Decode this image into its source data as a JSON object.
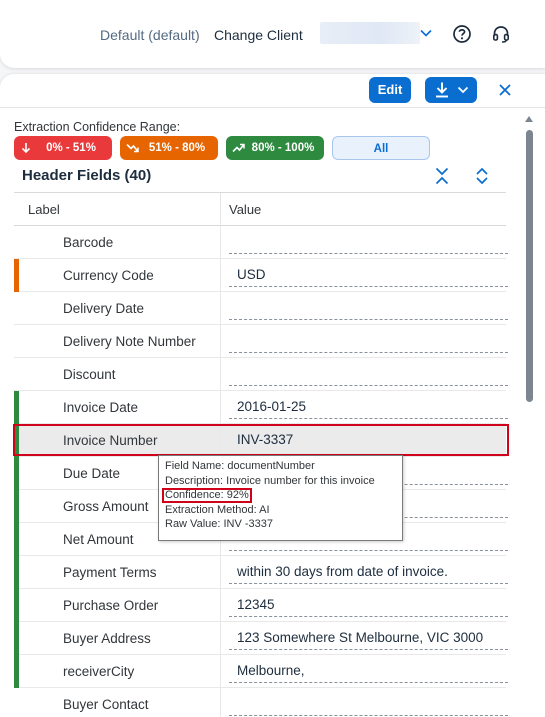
{
  "shell": {
    "client_default": "Default (default)",
    "change_client": "Change Client"
  },
  "toolbar": {
    "edit_label": "Edit"
  },
  "filters": {
    "range_label": "Extraction Confidence Range:",
    "chips": [
      {
        "label": "0% - 51%",
        "color": "#e9393a",
        "icon": "arrow-down-icon"
      },
      {
        "label": "51% - 80%",
        "color": "#e76500",
        "icon": "trend-down-icon"
      },
      {
        "label": "80% - 100%",
        "color": "#2e8a3f",
        "icon": "trend-up-icon"
      },
      {
        "label": "All",
        "color": "#e8f1fc",
        "icon": ""
      }
    ]
  },
  "section": {
    "title": "Header Fields (40)"
  },
  "table": {
    "columns": [
      "Label",
      "Value"
    ],
    "rows": [
      {
        "label": "Barcode",
        "value": "",
        "confidence": "none"
      },
      {
        "label": "Currency Code",
        "value": "USD",
        "confidence": "medium"
      },
      {
        "label": "Delivery Date",
        "value": "",
        "confidence": "none"
      },
      {
        "label": "Delivery Note Number",
        "value": "",
        "confidence": "none"
      },
      {
        "label": "Discount",
        "value": "",
        "confidence": "none"
      },
      {
        "label": "Invoice Date",
        "value": "2016-01-25",
        "confidence": "high"
      },
      {
        "label": "Invoice Number",
        "value": "INV-3337",
        "confidence": "high"
      },
      {
        "label": "Due Date",
        "value": "",
        "confidence": "high"
      },
      {
        "label": "Gross Amount",
        "value": "",
        "confidence": "high"
      },
      {
        "label": "Net Amount",
        "value": "",
        "confidence": "high"
      },
      {
        "label": "Payment Terms",
        "value": "within 30 days from date of invoice.",
        "confidence": "high"
      },
      {
        "label": "Purchase Order",
        "value": "12345",
        "confidence": "high"
      },
      {
        "label": "Buyer Address",
        "value": "123 Somewhere St Melbourne, VIC 3000",
        "confidence": "high"
      },
      {
        "label": "receiverCity",
        "value": "Melbourne,",
        "confidence": "high"
      },
      {
        "label": "Buyer Contact",
        "value": "",
        "confidence": "none"
      }
    ]
  },
  "tooltip": {
    "field_name": "Field Name: documentNumber",
    "description": "Description: Invoice number for this invoice",
    "confidence": "Confidence: 92%",
    "method": "Extraction Method: AI",
    "raw_value": "Raw Value: INV -3337"
  },
  "colors": {
    "accent": "#0a6ed1",
    "confidence_high": "#2e8a3f",
    "confidence_medium": "#e76500",
    "highlight": "#d0021b"
  }
}
